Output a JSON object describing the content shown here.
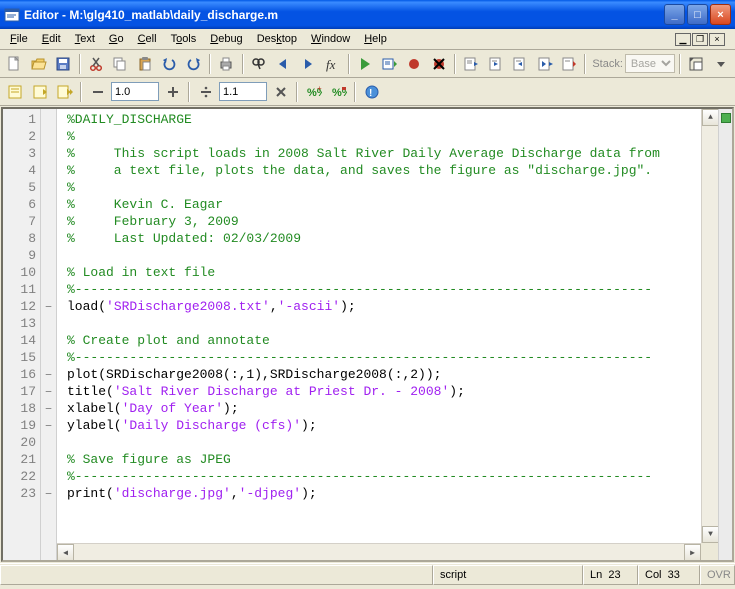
{
  "window": {
    "title": "Editor - M:\\glg410_matlab\\daily_discharge.m"
  },
  "menus": {
    "file": "File",
    "edit": "Edit",
    "text": "Text",
    "go": "Go",
    "cell": "Cell",
    "tools": "Tools",
    "debug": "Debug",
    "desktop": "Desktop",
    "window": "Window",
    "help": "Help"
  },
  "toolbar": {
    "stack_label": "Stack:",
    "stack_value": "Base"
  },
  "toolbar2": {
    "step": "1.0",
    "mult": "1.1"
  },
  "code_lines": [
    {
      "n": 1,
      "bp": "",
      "html": "<span class='cm'>%DAILY_DISCHARGE</span>"
    },
    {
      "n": 2,
      "bp": "",
      "html": "<span class='cm'>%</span>"
    },
    {
      "n": 3,
      "bp": "",
      "html": "<span class='cm'>%     This script loads in 2008 Salt River Daily Average Discharge data from</span>"
    },
    {
      "n": 4,
      "bp": "",
      "html": "<span class='cm'>%     a text file, plots the data, and saves the figure as \"discharge.jpg\".</span>"
    },
    {
      "n": 5,
      "bp": "",
      "html": "<span class='cm'>%</span>"
    },
    {
      "n": 6,
      "bp": "",
      "html": "<span class='cm'>%     Kevin C. Eagar</span>"
    },
    {
      "n": 7,
      "bp": "",
      "html": "<span class='cm'>%     February 3, 2009</span>"
    },
    {
      "n": 8,
      "bp": "",
      "html": "<span class='cm'>%     Last Updated: 02/03/2009</span>"
    },
    {
      "n": 9,
      "bp": "",
      "html": ""
    },
    {
      "n": 10,
      "bp": "",
      "html": "<span class='cm'>% Load in text file</span>"
    },
    {
      "n": 11,
      "bp": "",
      "html": "<span class='cm'>%--------------------------------------------------------------------------</span>"
    },
    {
      "n": 12,
      "bp": "–",
      "html": "load(<span class='st'>'SRDischarge2008.txt'</span>,<span class='st'>'-ascii'</span>);"
    },
    {
      "n": 13,
      "bp": "",
      "html": ""
    },
    {
      "n": 14,
      "bp": "",
      "html": "<span class='cm'>% Create plot and annotate</span>"
    },
    {
      "n": 15,
      "bp": "",
      "html": "<span class='cm'>%--------------------------------------------------------------------------</span>"
    },
    {
      "n": 16,
      "bp": "–",
      "html": "plot(SRDischarge2008(:,1),SRDischarge2008(:,2));"
    },
    {
      "n": 17,
      "bp": "–",
      "html": "title(<span class='st'>'Salt River Discharge at Priest Dr. - 2008'</span>);"
    },
    {
      "n": 18,
      "bp": "–",
      "html": "xlabel(<span class='st'>'Day of Year'</span>);"
    },
    {
      "n": 19,
      "bp": "–",
      "html": "ylabel(<span class='st'>'Daily Discharge (cfs)'</span>);"
    },
    {
      "n": 20,
      "bp": "",
      "html": ""
    },
    {
      "n": 21,
      "bp": "",
      "html": "<span class='cm'>% Save figure as JPEG</span>"
    },
    {
      "n": 22,
      "bp": "",
      "html": "<span class='cm'>%--------------------------------------------------------------------------</span>"
    },
    {
      "n": 23,
      "bp": "–",
      "html": "print(<span class='st'>'discharge.jpg'</span>,<span class='st'>'-djpeg'</span>);"
    }
  ],
  "status": {
    "type": "script",
    "ln_lbl": "Ln",
    "ln": "23",
    "col_lbl": "Col",
    "col": "33",
    "ovr": "OVR"
  }
}
